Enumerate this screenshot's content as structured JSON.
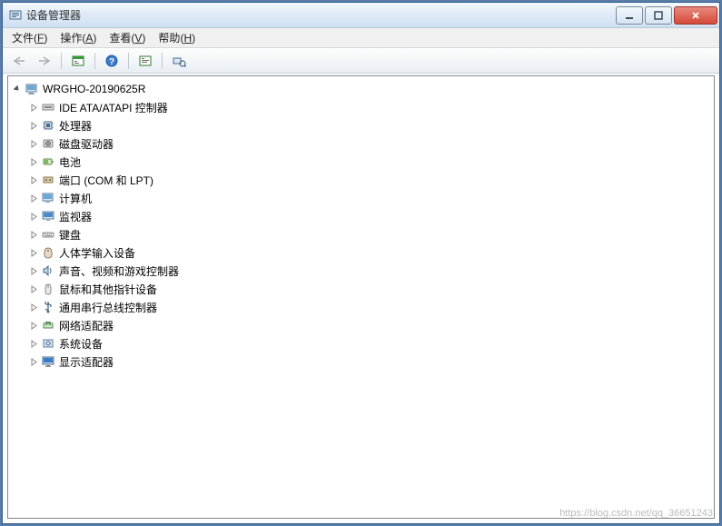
{
  "window": {
    "title": "设备管理器"
  },
  "menu": {
    "file": {
      "label": "文件",
      "mnemonic": "F"
    },
    "action": {
      "label": "操作",
      "mnemonic": "A"
    },
    "view": {
      "label": "查看",
      "mnemonic": "V"
    },
    "help": {
      "label": "帮助",
      "mnemonic": "H"
    }
  },
  "tree": {
    "root": {
      "label": "WRGHO-20190625R"
    },
    "items": [
      {
        "label": "IDE ATA/ATAPI 控制器",
        "icon": "ide"
      },
      {
        "label": "处理器",
        "icon": "cpu"
      },
      {
        "label": "磁盘驱动器",
        "icon": "disk"
      },
      {
        "label": "电池",
        "icon": "battery"
      },
      {
        "label": "端口 (COM 和 LPT)",
        "icon": "port"
      },
      {
        "label": "计算机",
        "icon": "computer"
      },
      {
        "label": "监视器",
        "icon": "monitor"
      },
      {
        "label": "键盘",
        "icon": "keyboard"
      },
      {
        "label": "人体学输入设备",
        "icon": "hid"
      },
      {
        "label": "声音、视频和游戏控制器",
        "icon": "sound"
      },
      {
        "label": "鼠标和其他指针设备",
        "icon": "mouse"
      },
      {
        "label": "通用串行总线控制器",
        "icon": "usb"
      },
      {
        "label": "网络适配器",
        "icon": "network"
      },
      {
        "label": "系统设备",
        "icon": "system"
      },
      {
        "label": "显示适配器",
        "icon": "display"
      }
    ]
  },
  "watermark": "https://blog.csdn.net/qq_36651243"
}
